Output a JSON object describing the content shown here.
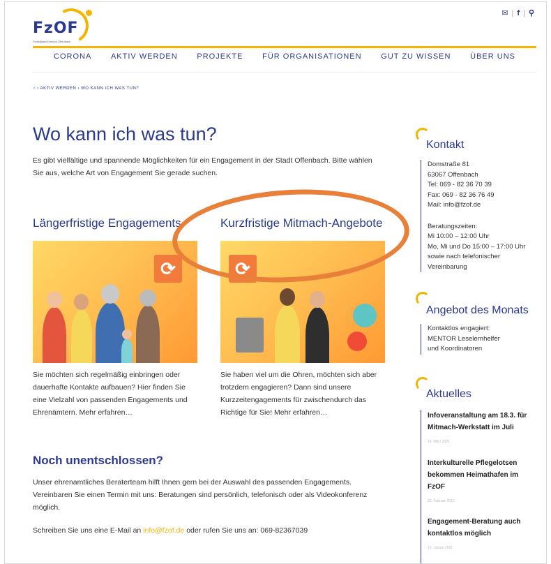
{
  "header": {
    "logo": "FzOF",
    "logo_sub": "FreiwilligenZentrum Offenbach",
    "icons": {
      "mail": "✉",
      "sep": "|",
      "facebook": "f",
      "search": "⚲"
    }
  },
  "nav": [
    "CORONA",
    "AKTIV WERDEN",
    "PROJEKTE",
    "FÜR ORGANISATIONEN",
    "GUT ZU WISSEN",
    "ÜBER UNS"
  ],
  "breadcrumb": "⌂  ›  AKTIV WERDEN  ›  WO KANN ICH WAS TUN?",
  "main": {
    "title": "Wo kann ich was tun?",
    "intro": "Es gibt vielfältige und spannende Möglichkeiten für ein Engagement in der Stadt Offenbach. Bitte wählen Sie aus, welche Art von Engagement Sie gerade suchen.",
    "cards": [
      {
        "heading": "Längerfristige Engagements",
        "text": "Sie möchten sich regelmäßig einbringen oder dauerhafte Kontakte aufbauen? Hier finden Sie eine Vielzahl von passenden Engagements und Ehrenämtern. Mehr erfahren…"
      },
      {
        "heading": "Kurzfristige Mitmach-Angebote",
        "text": "Sie haben viel um die Ohren, möchten sich aber trotzdem engagieren? Dann sind unsere Kurzzeitengagements für zwischendurch das Richtige für Sie! Mehr erfahren…"
      }
    ],
    "undecided": {
      "heading": "Noch unentschlossen?",
      "para1": "Unser ehrenamtliches Beraterteam hilft Ihnen gern bei der Auswahl des passenden Engagements. Vereinbaren Sie einen Termin mit uns: Beratungen sind persönlich, telefonisch oder als Videokonferenz möglich.",
      "para2_pre": "Schreiben Sie uns eine E-Mail an ",
      "email": "info@fzof.de",
      "para2_post": " oder rufen Sie uns an: 069-82367039"
    }
  },
  "sidebar": {
    "contact": {
      "heading": "Kontakt",
      "lines": [
        "Domstraße 81",
        "63067 Offenbach",
        "Tel: 069 - 82 36 70 39",
        "Fax: 069 - 82 36 76 49",
        "Mail: info@fzof.de"
      ],
      "hours_label": "Beratungszeiten:",
      "hours": [
        "Mi 10:00 – 12:00 Uhr",
        "Mo, Mi und Do 15:00 – 17:00 Uhr",
        "sowie nach telefonischer",
        "Vereinbarung"
      ]
    },
    "offer": {
      "heading": "Angebot des Monats",
      "text": "Kontaktlos engagiert: MENTOR Leselernhelfer und Koordinatoren"
    },
    "news": {
      "heading": "Aktuelles",
      "items": [
        {
          "title": "Infoveranstaltung am 18.3. für Mitmach-Werkstatt im Juli",
          "date": "16. März 2021"
        },
        {
          "title": "Interkulturelle Pflegelotsen bekommen Heimathafen im FzOF",
          "date": "22. Februar 2021"
        },
        {
          "title": "Engagement-Beratung auch kontaktlos möglich",
          "date": "12. Januar 2021"
        }
      ]
    }
  },
  "colors": {
    "brand_blue": "#2b3a8f",
    "brand_yellow": "#f5b400",
    "accent_orange": "#f27a3a",
    "annotation": "#e8803a"
  }
}
